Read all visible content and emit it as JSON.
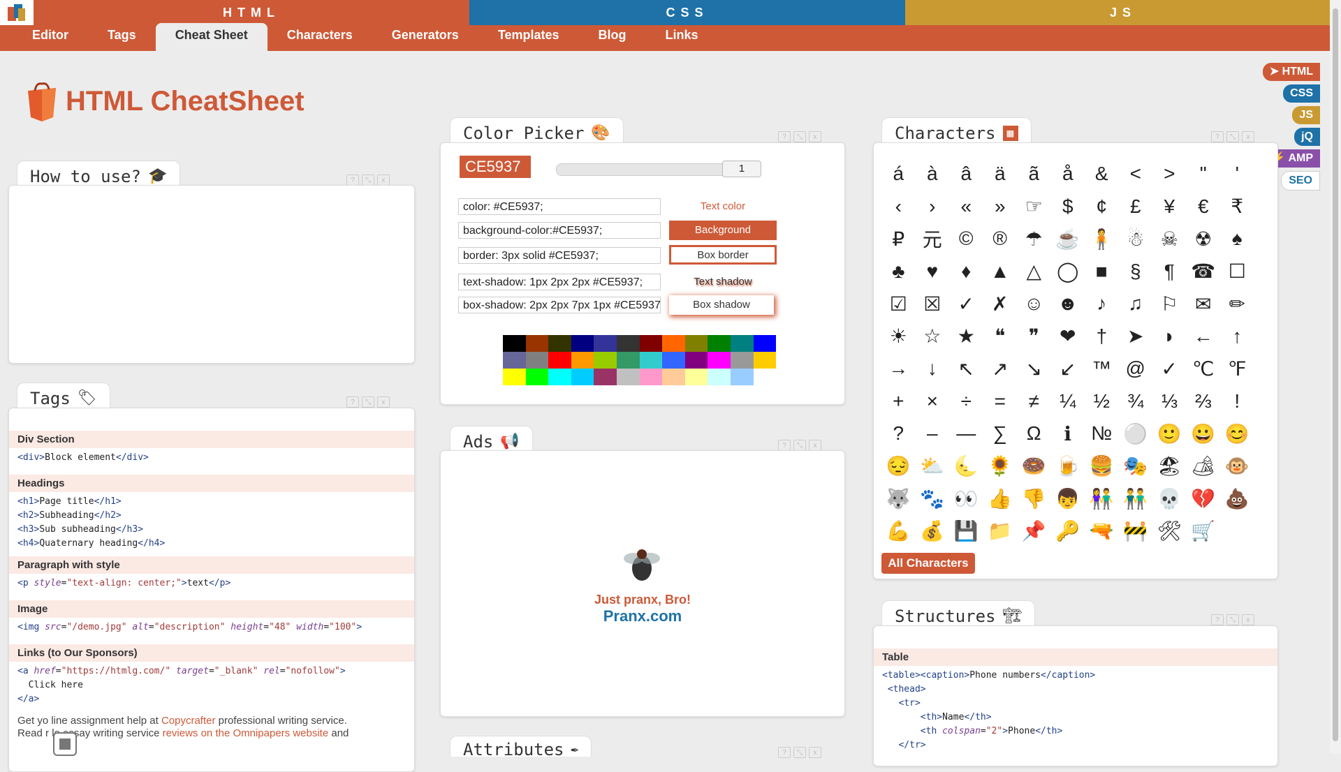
{
  "topbar": {
    "segments": [
      {
        "label": "HTML",
        "color": "#CE5937"
      },
      {
        "label": "CSS",
        "color": "#1e72a8"
      },
      {
        "label": "JS",
        "color": "#c99a32"
      }
    ]
  },
  "nav": {
    "items": [
      "Editor",
      "Tags",
      "Cheat Sheet",
      "Characters",
      "Generators",
      "Templates",
      "Blog",
      "Links"
    ],
    "active": "Cheat Sheet"
  },
  "page": {
    "title": "HTML CheatSheet"
  },
  "quicklinks": [
    {
      "label": "➤ HTML",
      "color": "#CE5937"
    },
    {
      "label": "CSS",
      "color": "#1e72a8"
    },
    {
      "label": "JS",
      "color": "#c99a32"
    },
    {
      "label": "jQ",
      "color": "#1e72a8"
    },
    {
      "label": "⚡ AMP",
      "color": "#8a4fa8"
    },
    {
      "label": "SEO",
      "color": "#ffffff"
    }
  ],
  "panels": {
    "how_to_use": {
      "title": "How to use?"
    },
    "tags": {
      "title": "Tags"
    },
    "color_picker": {
      "title": "Color Picker"
    },
    "ads": {
      "title": "Ads",
      "line1": "Just pranx, Bro!",
      "line2": "Pranx.com"
    },
    "characters": {
      "title": "Characters",
      "button": "All Characters"
    },
    "structures": {
      "title": "Structures",
      "section": "Table"
    },
    "attributes": {
      "title": "Attributes"
    }
  },
  "tags": {
    "sections": [
      {
        "heading": "Div Section"
      },
      {
        "heading": "Headings"
      },
      {
        "heading": "Paragraph with style"
      },
      {
        "heading": "Image"
      },
      {
        "heading": "Links (to Our Sponsors)"
      }
    ],
    "footer_text": "Get yo    line assignment help at ",
    "footer_link1": "Copycrafter",
    "footer_text2": " professional writing service.",
    "footer_text3": "Read r   le essay writing service ",
    "footer_link2": "reviews on the Omnipapers website",
    "footer_text4": " and"
  },
  "color_picker": {
    "hex": "CE5937",
    "hex_color": "#CE5937",
    "opacity": "1",
    "rows": [
      {
        "code": "color: #CE5937;",
        "button": "Text color"
      },
      {
        "code": "background-color:#CE5937;",
        "button": "Background"
      },
      {
        "code": "border: 3px solid #CE5937;",
        "button": "Box border"
      },
      {
        "code": "text-shadow: 1px 2px 2px #CE5937;",
        "button": "Text shadow"
      },
      {
        "code": "box-shadow: 2px 2px 7px 1px #CE5937;",
        "button": "Box shadow"
      }
    ],
    "palette": [
      "#000000",
      "#993300",
      "#333300",
      "#000080",
      "#333399",
      "#333333",
      "#800000",
      "#FF6600",
      "#808000",
      "#008000",
      "#008080",
      "#0000FF",
      "#666699",
      "#808080",
      "#FF0000",
      "#FF9900",
      "#99CC00",
      "#339966",
      "#33CCCC",
      "#3366FF",
      "#800080",
      "#FF00FF",
      "#999999",
      "#FFCC00",
      "#FFFF00",
      "#00FF00",
      "#00FFFF",
      "#00CCFF",
      "#993366",
      "#C0C0C0",
      "#FF99CC",
      "#FFCC99",
      "#FFFF99",
      "#CCFFFF",
      "#99CCFF"
    ]
  },
  "characters": [
    "á",
    "à",
    "â",
    "ä",
    "ã",
    "å",
    "&",
    "<",
    ">",
    "\"",
    "'",
    "‹",
    "›",
    "«",
    "»",
    "☞",
    "$",
    "¢",
    "£",
    "¥",
    "€",
    "₹",
    "₽",
    "元",
    "©",
    "®",
    "☂",
    "☕",
    "🧍",
    "☃",
    "☠",
    "☢",
    "♠",
    "♣",
    "♥",
    "♦",
    "▲",
    "△",
    "◯",
    "■",
    "§",
    "¶",
    "☎",
    "☐",
    "☑",
    "☒",
    "✓",
    "✗",
    "☺",
    "☻",
    "♪",
    "♫",
    "⚐",
    "✉",
    "✏",
    "☀",
    "☆",
    "★",
    "❝",
    "❞",
    "❤",
    "†",
    "➤",
    "◗",
    "←",
    "↑",
    "→",
    "↓",
    "↖",
    "↗",
    "↘",
    "↙",
    "™",
    "@",
    "✓",
    "℃",
    "℉",
    "+",
    "×",
    "÷",
    "=",
    "≠",
    "¼",
    "½",
    "¾",
    "⅓",
    "⅔",
    "!",
    "?",
    "–",
    "—",
    "∑",
    "Ω",
    "ℹ",
    "№",
    "⚪",
    "🙂",
    "😀",
    "😊",
    "😔",
    "⛅",
    "🌜",
    "🌻",
    "🍩",
    "🍺",
    "🍔",
    "🎭",
    "🏖",
    "🏕",
    "🐵",
    "🐺",
    "🐾",
    "👀",
    "👍",
    "👎",
    "👦",
    "👫",
    "👬",
    "💀",
    "💔",
    "💩",
    "💪",
    "💰",
    "💾",
    "📁",
    "📌",
    "🔑",
    "🔫",
    "🚧",
    "🛠",
    "🛒"
  ],
  "structures": {
    "code_lines": [
      "<table><caption>Phone numbers</caption>",
      " <thead>",
      "  <tr>",
      "      <th>Name</th>",
      "      <th colspan=\"2\">Phone</th>",
      "  </tr>"
    ]
  }
}
